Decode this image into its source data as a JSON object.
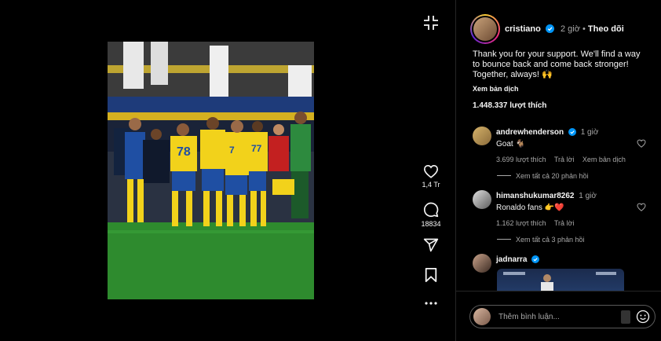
{
  "post": {
    "author": "cristiano",
    "time": "2 giờ",
    "separator": "•",
    "follow_label": "Theo dõi",
    "caption": "Thank you for your support. We'll find a way to bounce back and come back stronger! Together, always! 🙌",
    "see_translation": "Xem bản dịch",
    "likes": "1.448.337 lượt thích"
  },
  "actions": {
    "like_count": "1,4 Tr",
    "comment_count": "18834"
  },
  "comments": [
    {
      "user": "andrewhenderson",
      "verified": true,
      "time": "1 giờ",
      "text": "Goat 🐐",
      "likes": "3.699 lượt thích",
      "reply": "Trả lời",
      "translate": "Xem bản dịch",
      "view_replies": "Xem tất cả 20 phản hồi"
    },
    {
      "user": "himanshukumar8262",
      "verified": false,
      "time": "1 giờ",
      "text": "Ronaldo fans 👉❤️",
      "likes": "1.162 lượt thích",
      "reply": "Trả lời",
      "view_replies": "Xem tất cả 3 phản hồi"
    },
    {
      "user": "jadnarra",
      "verified": true
    }
  ],
  "composer": {
    "placeholder": "Thêm bình luận..."
  },
  "colors": {
    "background": "#000000",
    "text": "#f5f5f5",
    "muted": "#a8a8a8",
    "verified": "#0095f6",
    "heart_red": "#ed4956",
    "pitch_green": "#2e8b2e",
    "jersey_yellow": "#f2d21b",
    "shorts_blue": "#1f4fa3"
  }
}
